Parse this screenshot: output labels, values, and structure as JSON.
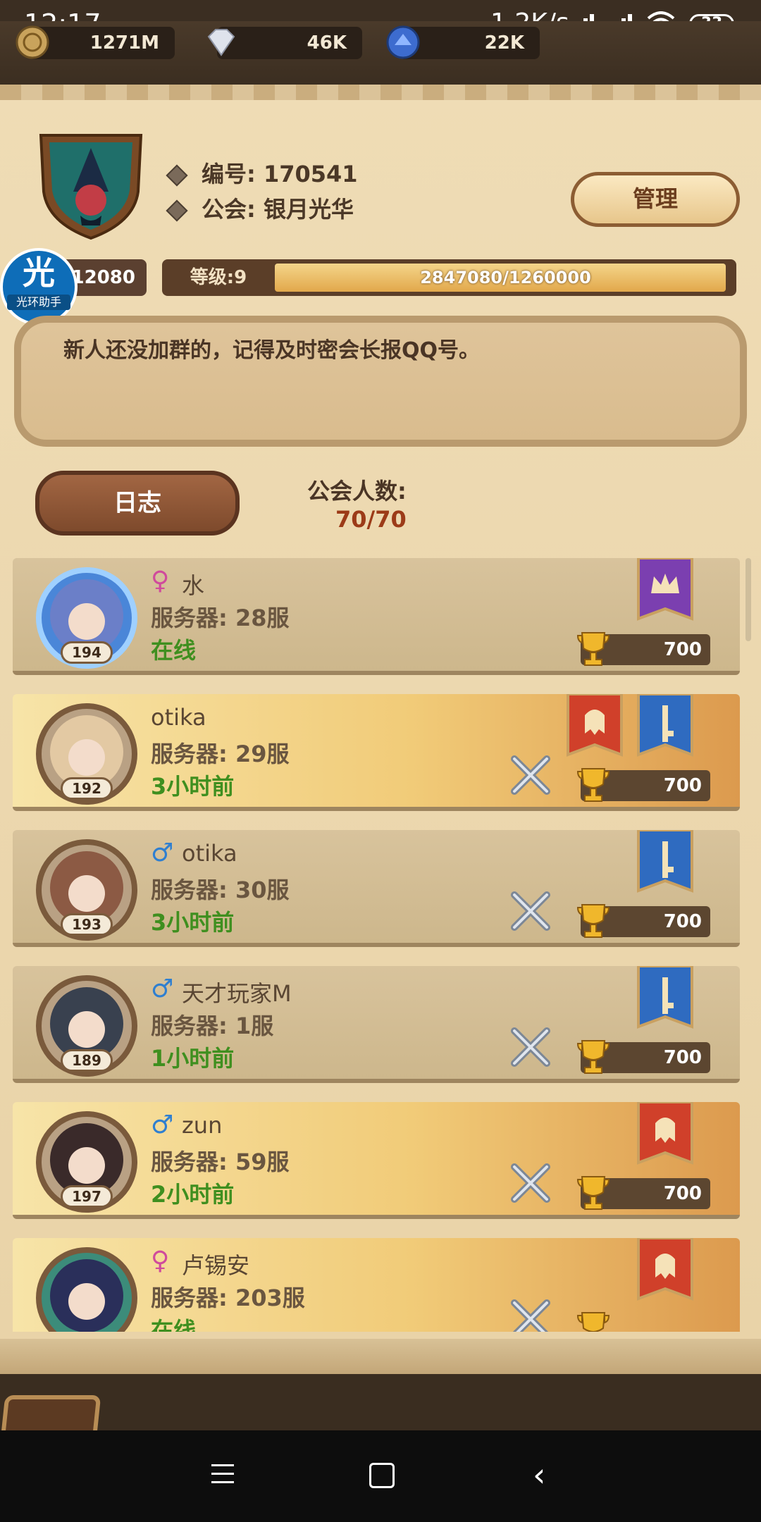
{
  "status_bar": {
    "time": "12:17",
    "network_speed": "1.2K/s",
    "battery": "33"
  },
  "resources": [
    {
      "value": "1271M",
      "icon": "gold-coin-icon"
    },
    {
      "value": "46K",
      "icon": "diamond-icon"
    },
    {
      "value": "22K",
      "icon": "blue-gem-icon"
    }
  ],
  "guild": {
    "id_label": "编号: 170541",
    "name_label": "公会: 银月光华",
    "manage_button": "管理",
    "exp_left_value": "12080",
    "level_label": "等级:9",
    "exp_text": "2847080/1260000",
    "exp_progress": 1.0,
    "notice": "新人还没加群的，记得及时密会长报QQ号。",
    "log_button": "日志",
    "member_count_label": "公会人数:",
    "member_count": "70/70"
  },
  "helper_overlay": {
    "glyph": "光",
    "label": "光环助手"
  },
  "members": [
    {
      "name": "水",
      "gender": "female",
      "gender_icon": "♀",
      "server": "服务器: 28服",
      "status": "在线",
      "level": "194",
      "trophy": "700",
      "style": "plain",
      "banners": [
        "purple-crown"
      ],
      "swords": false
    },
    {
      "name": "otika",
      "gender": "none",
      "gender_icon": "",
      "server": "服务器: 29服",
      "status": "3小时前",
      "level": "192",
      "trophy": "700",
      "style": "gold",
      "banners": [
        "red-helmet",
        "blue-key"
      ],
      "swords": true
    },
    {
      "name": "otika",
      "gender": "male",
      "gender_icon": "♂",
      "server": "服务器: 30服",
      "status": "3小时前",
      "level": "193",
      "trophy": "700",
      "style": "plain",
      "banners": [
        "blue-key"
      ],
      "swords": true
    },
    {
      "name": "天才玩家M",
      "gender": "male",
      "gender_icon": "♂",
      "server": "服务器: 1服",
      "status": "1小时前",
      "level": "189",
      "trophy": "700",
      "style": "plain",
      "banners": [
        "blue-key"
      ],
      "swords": true
    },
    {
      "name": "zun",
      "gender": "male",
      "gender_icon": "♂",
      "server": "服务器: 59服",
      "status": "2小时前",
      "level": "197",
      "trophy": "700",
      "style": "gold",
      "banners": [
        "red-helmet"
      ],
      "swords": true
    },
    {
      "name": "卢锡安",
      "gender": "female",
      "gender_icon": "♀",
      "server": "服务器: 203服",
      "status": "在线",
      "level": "",
      "trophy": "",
      "style": "gold",
      "banners": [
        "red-helmet"
      ],
      "swords": true
    }
  ],
  "colors": {
    "online": "#3f8f1f",
    "count_red": "#9c3b18",
    "panel": "#ecd6ab"
  }
}
